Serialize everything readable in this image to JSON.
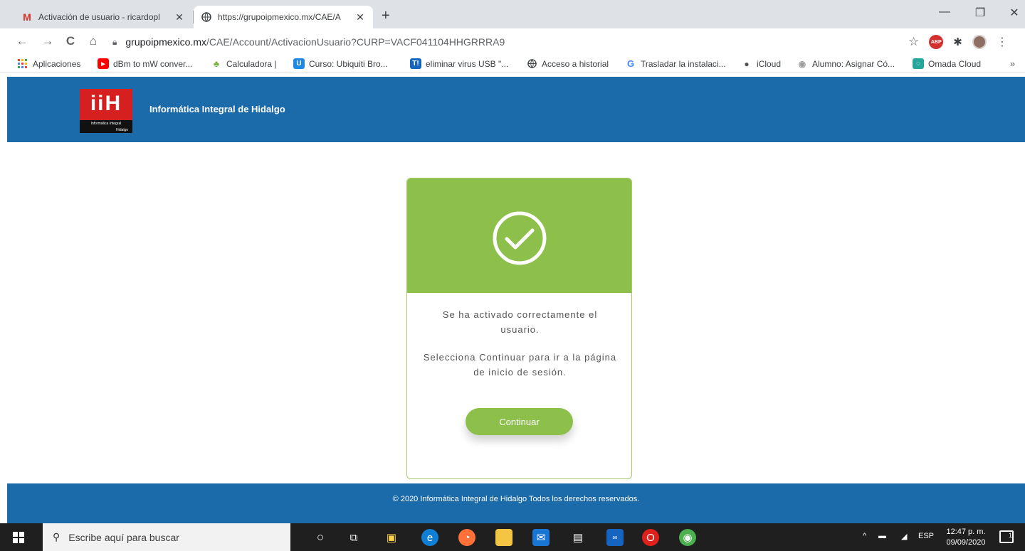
{
  "browser": {
    "tabs": [
      {
        "title": "Activación de usuario - ricardopl",
        "favicon": "gmail-icon"
      },
      {
        "title": "https://grupoipmexico.mx/CAE/A",
        "favicon": "globe-icon"
      }
    ],
    "address": {
      "host": "grupoipmexico.mx",
      "path": "/CAE/Account/ActivacionUsuario?CURP=VACF041104HHGRRRA9"
    },
    "bookmarks": [
      {
        "label": "Aplicaciones",
        "icon": "apps-grid-icon"
      },
      {
        "label": "dBm to mW conver...",
        "icon": "youtube-icon"
      },
      {
        "label": "Calculadora |",
        "icon": "android-icon"
      },
      {
        "label": "Curso: Ubiquiti Bro...",
        "icon": "udemy-icon"
      },
      {
        "label": "eliminar virus USB \"...",
        "icon": "t-logo-icon"
      },
      {
        "label": "Acceso a historial",
        "icon": "globe-icon"
      },
      {
        "label": "Trasladar la instalaci...",
        "icon": "google-icon"
      },
      {
        "label": "iCloud",
        "icon": "apple-icon"
      },
      {
        "label": "Alumno: Asignar Có...",
        "icon": "site-icon"
      },
      {
        "label": "Omada Cloud",
        "icon": "omada-icon"
      }
    ]
  },
  "site": {
    "logo_letters": "iiH",
    "logo_band_top": "Informática Integral",
    "logo_band_bottom": "Hidalgo",
    "brand_name": "Informática Integral de Hidalgo",
    "card": {
      "message_1": "Se ha activado correctamente el usuario.",
      "message_2": "Selecciona Continuar para ir a la página de inicio de sesión.",
      "continue_label": "Continuar"
    },
    "footer": "© 2020 Informática Integral de Hidalgo Todos los derechos reservados."
  },
  "taskbar": {
    "search_placeholder": "Escribe aquí para buscar",
    "language": "ESP",
    "time": "12:47 p. m.",
    "date": "09/09/2020",
    "notification_count": "1"
  },
  "colors": {
    "header_blue": "#1b6aaa",
    "success_green": "#8dc04b",
    "logo_red": "#d61f1f"
  }
}
